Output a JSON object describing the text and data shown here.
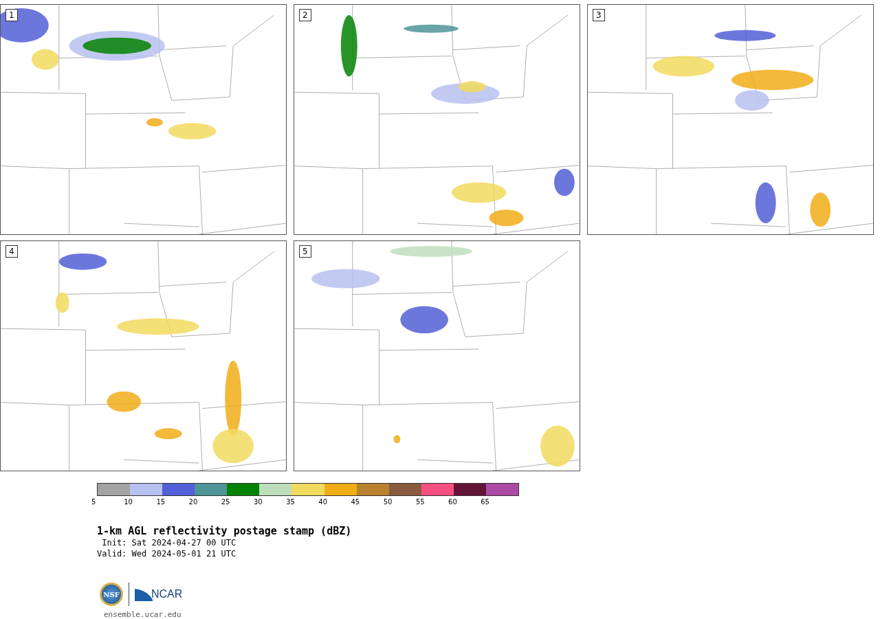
{
  "panels": [
    {
      "label": "1"
    },
    {
      "label": "2"
    },
    {
      "label": "3"
    },
    {
      "label": "4"
    },
    {
      "label": "5"
    }
  ],
  "colorbar": {
    "bins": [
      {
        "color": "#a3a3a3"
      },
      {
        "color": "#b7c1f0"
      },
      {
        "color": "#525fd6"
      },
      {
        "color": "#4f9499"
      },
      {
        "color": "#038203"
      },
      {
        "color": "#bedebe"
      },
      {
        "color": "#f1db5e"
      },
      {
        "color": "#f1ad17"
      },
      {
        "color": "#b9812e"
      },
      {
        "color": "#8a5a3e"
      },
      {
        "color": "#f74f7f"
      },
      {
        "color": "#631436"
      },
      {
        "color": "#ad4aa3"
      }
    ],
    "ticks": [
      "5",
      "10",
      "15",
      "20",
      "25",
      "30",
      "35",
      "40",
      "45",
      "50",
      "55",
      "60",
      "65"
    ]
  },
  "title": "1-km AGL reflectivity postage stamp (dBZ)",
  "init": " Init: Sat 2024-04-27 00 UTC",
  "valid": "Valid: Wed 2024-05-01 21 UTC",
  "logo": {
    "seal_text": "NSF",
    "wordmark": "NCAR"
  },
  "url": "ensemble.ucar.edu"
}
